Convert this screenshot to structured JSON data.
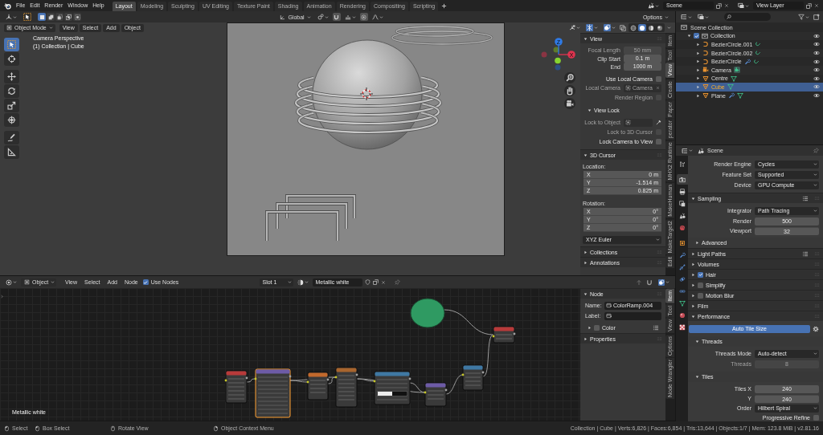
{
  "topbar": {
    "menus": [
      "File",
      "Edit",
      "Render",
      "Window",
      "Help"
    ],
    "workspaces": [
      {
        "label": "Layout",
        "selected": true
      },
      {
        "label": "Modeling",
        "selected": false
      },
      {
        "label": "Sculpting",
        "selected": false
      },
      {
        "label": "UV Editing",
        "selected": false
      },
      {
        "label": "Texture Paint",
        "selected": false
      },
      {
        "label": "Shading",
        "selected": false
      },
      {
        "label": "Animation",
        "selected": false
      },
      {
        "label": "Rendering",
        "selected": false
      },
      {
        "label": "Compositing",
        "selected": false
      },
      {
        "label": "Scripting",
        "selected": false
      }
    ],
    "scene": "Scene",
    "view_layer": "View Layer"
  },
  "viewport": {
    "tool_header": {
      "modes": [
        {
          "selected": true
        },
        {
          "selected": false
        },
        {
          "selected": false
        },
        {
          "selected": false
        },
        {
          "selected": false
        }
      ],
      "orientation": "Global",
      "options": "Options"
    },
    "header": {
      "mode": "Object Mode",
      "menus": [
        "View",
        "Select",
        "Add",
        "Object"
      ],
      "shading": [
        {
          "kind": "wireframe",
          "selected": false
        },
        {
          "kind": "solid",
          "selected": true
        },
        {
          "kind": "material",
          "selected": false
        },
        {
          "kind": "rendered",
          "selected": false
        }
      ]
    },
    "overlay_text": [
      "Camera Perspective",
      "(1) Collection | Cube"
    ],
    "navigation_gizmo": {
      "axes": [
        {
          "label": "Z"
        },
        {
          "label": "X"
        }
      ]
    },
    "tools": [
      {
        "kind": "select-box",
        "selected": true
      },
      {
        "kind": "cursor",
        "selected": false
      },
      {
        "kind": "move",
        "selected": false
      },
      {
        "kind": "rotate",
        "selected": false
      },
      {
        "kind": "scale",
        "selected": false
      },
      {
        "kind": "transform",
        "selected": false
      },
      {
        "kind": "annotate",
        "selected": false
      },
      {
        "kind": "measure",
        "selected": false
      }
    ],
    "sidebar": {
      "rows": [
        {
          "kind": "panel",
          "label": "View",
          "expanded": true
        },
        {
          "kind": "number",
          "label": "Focal Length",
          "value": "50 mm",
          "disabled": true
        },
        {
          "kind": "number",
          "label": "Clip Start",
          "value": "0.1 m",
          "disabled": false
        },
        {
          "kind": "number",
          "label": "End",
          "value": "1000 m",
          "disabled": false
        },
        {
          "kind": "checkbox",
          "label": "Use Local Camera",
          "checked": false,
          "disabled": false
        },
        {
          "kind": "object",
          "label": "Local Camera",
          "value": "Camera",
          "clearable": true,
          "eyedropper": false,
          "disabled": true
        },
        {
          "kind": "checkbox",
          "label": "Render Region",
          "checked": false,
          "disabled": true
        },
        {
          "kind": "subpanel",
          "label": "View Lock",
          "expanded": true
        },
        {
          "kind": "object",
          "label": "Lock to Object",
          "clearable": false,
          "eyedropper": true,
          "disabled": true
        },
        {
          "kind": "checkbox",
          "label": "Lock to 3D Cursor",
          "checked": false,
          "disabled": true
        },
        {
          "kind": "checkbox",
          "label": "Lock Camera to View",
          "checked": false,
          "disabled": false
        },
        {
          "kind": "panel",
          "label": "3D Cursor",
          "expanded": true
        },
        {
          "kind": "label",
          "label": "Location:"
        },
        {
          "kind": "vector",
          "items": [
            {
              "axis": "X",
              "value": "0 m"
            },
            {
              "axis": "Y",
              "value": "-1.514 m"
            },
            {
              "axis": "Z",
              "value": "0.825 m"
            }
          ]
        },
        {
          "kind": "label",
          "label": "Rotation:"
        },
        {
          "kind": "vector",
          "items": [
            {
              "axis": "X",
              "value": "0°"
            },
            {
              "axis": "Y",
              "value": "0°"
            },
            {
              "axis": "Z",
              "value": "0°"
            }
          ]
        },
        {
          "kind": "dropdown",
          "value": "XYZ Euler",
          "disabled": false
        },
        {
          "kind": "panel",
          "label": "Collections",
          "expanded": false
        },
        {
          "kind": "panel",
          "label": "Annotations",
          "expanded": false
        }
      ],
      "tabs": [
        {
          "label": "Item",
          "selected": false
        },
        {
          "label": "Tool",
          "selected": false
        },
        {
          "label": "View",
          "selected": true
        },
        {
          "label": "Create",
          "selected": false
        },
        {
          "label": "Paper",
          "selected": false
        },
        {
          "label": "perator",
          "selected": false
        },
        {
          "label": "MHX2 Runtime",
          "selected": false
        },
        {
          "label": "MakeHuman",
          "selected": false
        },
        {
          "label": "MakeTarget2",
          "selected": false
        },
        {
          "label": "Edit",
          "selected": false
        }
      ]
    }
  },
  "outliner": {
    "root": "Scene Collection",
    "items": [
      {
        "label": "Collection",
        "kind": "collection",
        "checked": true,
        "expanded": true,
        "selected": false,
        "children": [
          {
            "label": "BezierCircle.001",
            "kind": "curve",
            "expanded": false,
            "selected": false,
            "data": [
              {
                "kind": "curve-data"
              }
            ]
          },
          {
            "label": "BezierCircle.002",
            "kind": "curve",
            "expanded": false,
            "selected": false,
            "data": [
              {
                "kind": "curve-data"
              }
            ]
          },
          {
            "label": "BezierCircle",
            "kind": "curve",
            "expanded": false,
            "selected": false,
            "data": [
              {
                "kind": "modifier"
              },
              {
                "kind": "curve-data"
              }
            ]
          },
          {
            "label": "Camera",
            "kind": "camera",
            "expanded": false,
            "selected": false,
            "data": [
              {
                "kind": "camera-data"
              }
            ]
          },
          {
            "label": "Centre",
            "kind": "mesh",
            "expanded": false,
            "selected": false,
            "data": [
              {
                "kind": "mesh-data"
              }
            ]
          },
          {
            "label": "Cube",
            "kind": "mesh",
            "expanded": false,
            "selected": true,
            "data": [
              {
                "kind": "mesh-data"
              }
            ]
          },
          {
            "label": "Plane",
            "kind": "mesh",
            "expanded": false,
            "selected": false,
            "data": [
              {
                "kind": "modifier"
              },
              {
                "kind": "mesh-data"
              }
            ]
          }
        ]
      }
    ]
  },
  "properties": {
    "context": "Scene",
    "tabs": [
      {
        "kind": "tool",
        "selected": false
      },
      {
        "kind": "render",
        "selected": true
      },
      {
        "kind": "output",
        "selected": false
      },
      {
        "kind": "view-layer",
        "selected": false
      },
      {
        "kind": "scene",
        "selected": false
      },
      {
        "kind": "world",
        "selected": false
      },
      {
        "kind": "object",
        "selected": false
      },
      {
        "kind": "modifiers",
        "selected": false
      },
      {
        "kind": "particles",
        "selected": false
      },
      {
        "kind": "physics",
        "selected": false
      },
      {
        "kind": "constraints",
        "selected": false
      },
      {
        "kind": "data",
        "selected": false
      },
      {
        "kind": "material",
        "selected": false
      },
      {
        "kind": "texture",
        "selected": false
      }
    ],
    "rows": [
      {
        "kind": "dropdown",
        "label": "Render Engine",
        "value": "Cycles",
        "disabled": false
      },
      {
        "kind": "dropdown",
        "label": "Feature Set",
        "value": "Supported",
        "disabled": false
      },
      {
        "kind": "dropdown",
        "label": "Device",
        "value": "GPU Compute",
        "disabled": false
      },
      {
        "kind": "panel",
        "label": "Sampling",
        "expanded": true,
        "presets": true
      },
      {
        "kind": "dropdown",
        "label": "Integrator",
        "value": "Path Tracing",
        "disabled": false
      },
      {
        "kind": "number",
        "label": "Render",
        "value": "500",
        "disabled": false
      },
      {
        "kind": "number",
        "label": "Viewport",
        "value": "32",
        "disabled": false
      },
      {
        "kind": "subpanel",
        "label": "Advanced",
        "expanded": false
      },
      {
        "kind": "panel",
        "label": "Light Paths",
        "expanded": false,
        "presets": true
      },
      {
        "kind": "panel",
        "label": "Volumes",
        "expanded": false,
        "presets": false
      },
      {
        "kind": "panel",
        "label": "Hair",
        "expanded": false,
        "checked": true,
        "presets": false
      },
      {
        "kind": "panel",
        "label": "Simplify",
        "expanded": false,
        "checked": false,
        "presets": false
      },
      {
        "kind": "panel",
        "label": "Motion Blur",
        "expanded": false,
        "checked": false,
        "presets": false
      },
      {
        "kind": "panel",
        "label": "Film",
        "expanded": false,
        "presets": false
      },
      {
        "kind": "panel",
        "label": "Performance",
        "expanded": true,
        "presets": false
      },
      {
        "kind": "toggle",
        "label": "Auto Tile Size",
        "on": true
      },
      {
        "kind": "subpanel",
        "label": "Threads",
        "expanded": true
      },
      {
        "kind": "dropdown",
        "label": "Threads Mode",
        "value": "Auto-detect",
        "disabled": false
      },
      {
        "kind": "number",
        "label": "Threads",
        "value": "8",
        "disabled": true
      },
      {
        "kind": "subpanel",
        "label": "Tiles",
        "expanded": true
      },
      {
        "kind": "number",
        "label": "Tiles X",
        "value": "240",
        "disabled": false
      },
      {
        "kind": "number",
        "label": "Y",
        "value": "240",
        "disabled": false
      },
      {
        "kind": "dropdown",
        "label": "Order",
        "value": "Hilbert Spiral",
        "disabled": false
      },
      {
        "kind": "checkbox",
        "label": "Progressive Refine",
        "checked": false,
        "disabled": false
      }
    ]
  },
  "node_editor": {
    "header": {
      "type": "Object",
      "menus": [
        "View",
        "Select",
        "Add",
        "Node"
      ],
      "use_nodes": {
        "label": "Use Nodes",
        "checked": true
      },
      "slot": "Slot 1",
      "material": "Metallic white"
    },
    "nodes": [
      {
        "kind": "node",
        "color": "#b83a3a",
        "selected": false
      },
      {
        "kind": "node",
        "color": "#6d5ba6",
        "selected": true
      },
      {
        "kind": "node",
        "color": "#c2692c",
        "selected": false
      },
      {
        "kind": "node",
        "color": "#a8652e",
        "selected": false
      },
      {
        "kind": "ramp",
        "color": "#3f78a3",
        "selected": false
      },
      {
        "kind": "node",
        "color": "#6d5ba6",
        "selected": false
      },
      {
        "kind": "node",
        "color": "#3f78a3",
        "selected": false
      },
      {
        "kind": "node",
        "color": "#b83a3a",
        "selected": false
      },
      {
        "kind": "round",
        "color": "#2f9a62",
        "selected": false
      }
    ],
    "material_label": "Metallic white",
    "sidebar": {
      "rows": [
        {
          "kind": "panel",
          "label": "Node",
          "expanded": true
        },
        {
          "kind": "name",
          "label": "Name:",
          "value": "ColorRamp.004"
        },
        {
          "kind": "name",
          "label": "Label:"
        },
        {
          "kind": "subpanel",
          "label": "Color",
          "expanded": false,
          "checked": false,
          "presets": true
        },
        {
          "kind": "panel",
          "label": "Properties",
          "expanded": false
        }
      ],
      "tabs": [
        {
          "label": "Item",
          "selected": true
        },
        {
          "label": "Tool",
          "selected": false
        },
        {
          "label": "View",
          "selected": false
        },
        {
          "label": "Options",
          "selected": false
        },
        {
          "label": "Node Wrangler",
          "selected": false
        }
      ]
    }
  },
  "status_bar": {
    "hints": [
      {
        "kind": "mouse-left",
        "label": "Select"
      },
      {
        "kind": "mouse-left",
        "label": "Box Select"
      },
      {
        "kind": "mouse-middle",
        "label": "Rotate View"
      },
      {
        "kind": "mouse-right",
        "label": "Object Context Menu"
      }
    ],
    "stats": "Collection | Cube | Verts:6,826 | Faces:6,854 | Tris:13,644 | Objects:1/7 | Mem: 123.8 MiB | v2.81.16"
  }
}
